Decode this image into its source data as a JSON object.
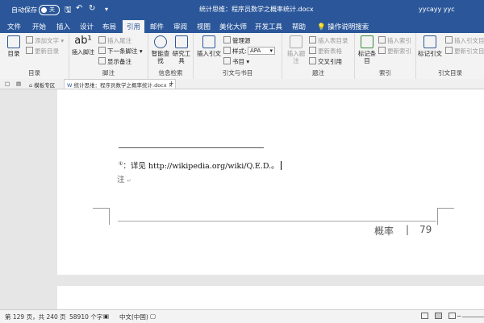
{
  "titlebar": {
    "autosave_label": "自动保存",
    "autosave_state": "关",
    "doc_title": "统计思维：程序员数学之概率统计.docx",
    "user": "yycayy yyc"
  },
  "tabs": [
    "文件",
    "开始",
    "插入",
    "设计",
    "布局",
    "引用",
    "邮件",
    "审阅",
    "视图",
    "美化大师",
    "开发工具",
    "帮助"
  ],
  "active_tab": "引用",
  "tell_me": "操作说明搜索",
  "ribbon": {
    "toc": {
      "big_label": "目录",
      "add_text": "添加文字",
      "update_toc": "更新目录",
      "group": "目录"
    },
    "footnotes": {
      "insert_footnote": "插入脚注",
      "insert_endnote": "插入尾注",
      "next_footnote": "下一条脚注",
      "show_notes": "显示备注",
      "group": "脚注"
    },
    "research": {
      "smart_lookup": "智能查找",
      "researcher": "研究工具",
      "group": "信息检索"
    },
    "citations": {
      "insert_citation": "插入引文",
      "manage_sources": "管理源",
      "style_label": "样式:",
      "style_value": "APA",
      "bibliography": "书目",
      "group": "引文与书目"
    },
    "captions": {
      "insert_caption": "插入题注",
      "insert_table_of_figures": "插入表目录",
      "update_table": "更新表格",
      "cross_reference": "交叉引用",
      "group": "题注"
    },
    "index": {
      "mark_entry": "标记条目",
      "insert_index": "插入索引",
      "update_index": "更新索引",
      "group": "索引"
    },
    "toa": {
      "mark_citation": "标记引文",
      "insert_toa": "插入引文目",
      "update_toa": "更新引文目",
      "group": "引文目录"
    }
  },
  "doc_tabs": [
    "模板专区",
    "统计思维：程序员数学之概率统计.docx"
  ],
  "document": {
    "footnote_marker": "①",
    "footnote_text": "：详见 http://wikipedia.org/wiki/Q.E.D.。",
    "note_label": "注",
    "footer_text": "概率",
    "footer_sep": "|",
    "page_number": "79"
  },
  "statusbar": {
    "page": "第 129 页，共 240 页",
    "words": "58910 个字",
    "language": "中文(中国)"
  }
}
